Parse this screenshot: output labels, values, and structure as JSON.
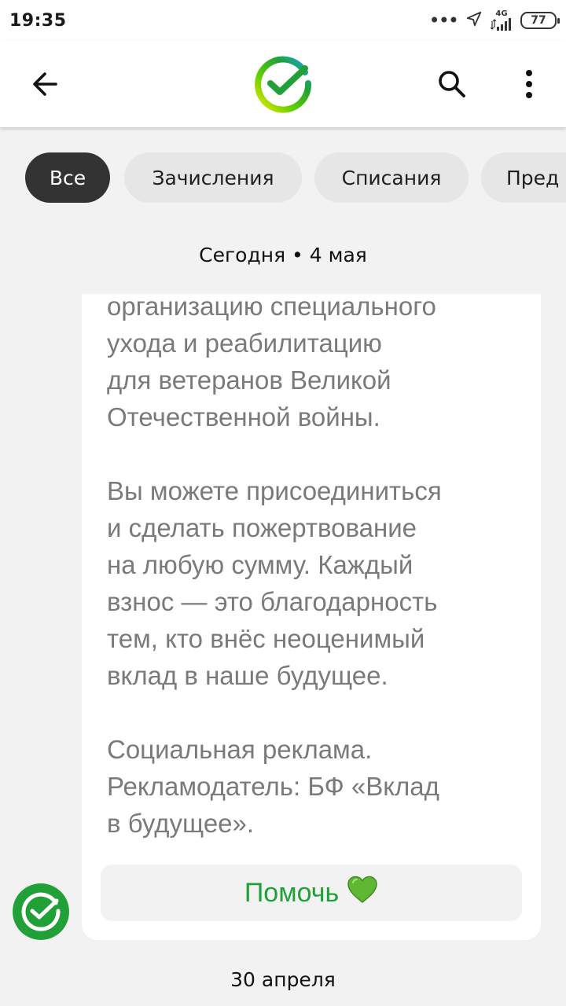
{
  "status_bar": {
    "time": "19:35",
    "network_label": "4G",
    "battery": "77"
  },
  "toolbar": {
    "back_icon": "arrow-left-icon",
    "logo": "sber-logo",
    "search_icon": "search-icon",
    "more_icon": "more-vertical-icon"
  },
  "filters": [
    {
      "label": "Все",
      "active": true
    },
    {
      "label": "Зачисления",
      "active": false
    },
    {
      "label": "Списания",
      "active": false
    },
    {
      "label": "Пред",
      "active": false
    }
  ],
  "feed": {
    "date_today": "Сегодня • 4 мая",
    "message": {
      "paragraphs": [
        [
          "организацию специального",
          "ухода и реабилитацию",
          "для ветеранов Великой",
          "Отечественной войны."
        ],
        [
          "Вы можете присоединиться",
          "и сделать пожертвование",
          "на любую сумму. Каждый",
          "взнос — это благодарность",
          "тем, кто внёс неоценимый",
          "вклад в наше будущее."
        ],
        [
          "Социальная реклама.",
          "Рекламодатель: БФ «Вклад",
          "в будущее»."
        ]
      ],
      "button_label": "Помочь",
      "button_emoji": "💚"
    },
    "date_next": "30 апреля"
  },
  "colors": {
    "brand_green": "#21a038",
    "chip_active": "#333333",
    "chip_inactive": "#e6e6e6",
    "background": "#f2f2f2"
  }
}
